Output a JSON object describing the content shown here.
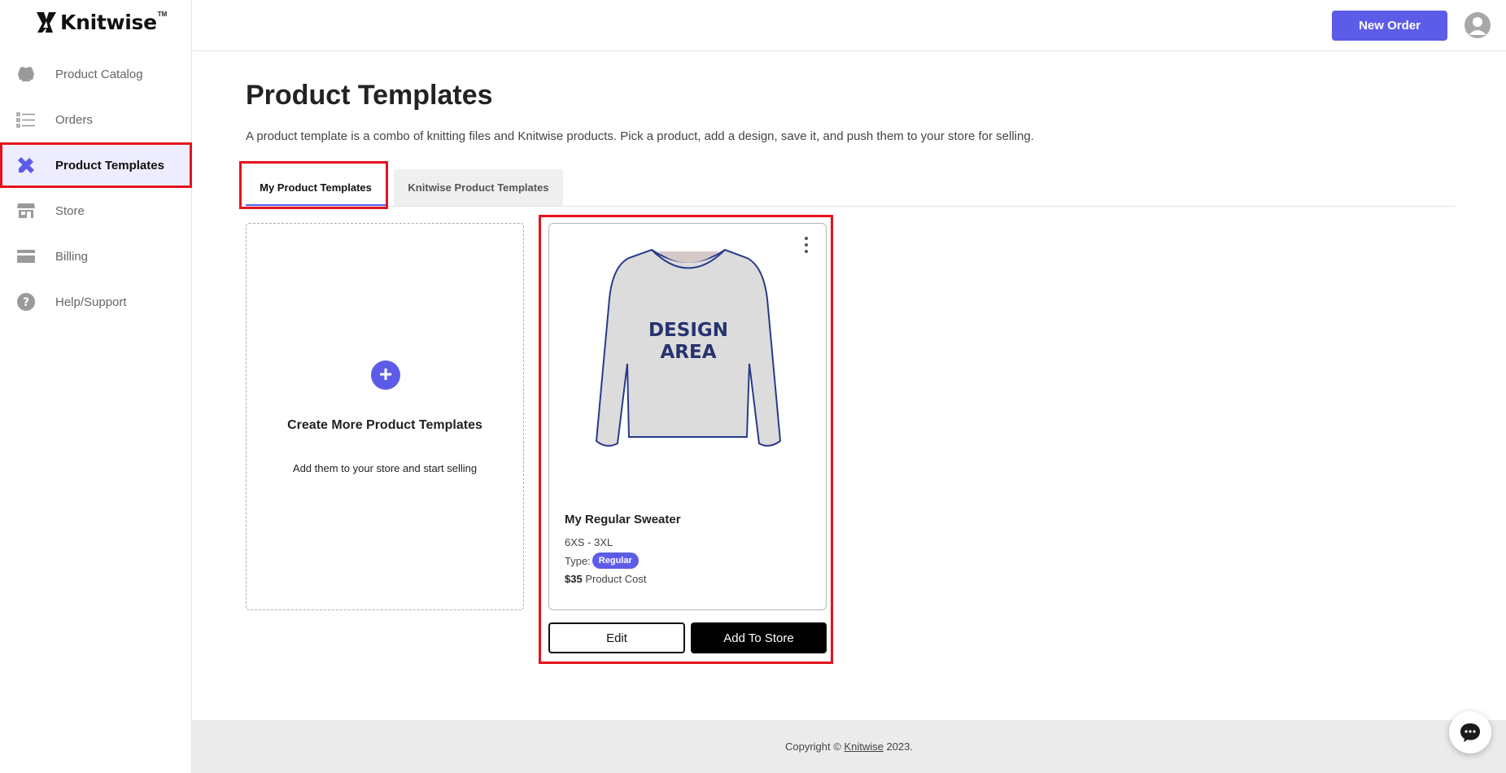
{
  "brand": {
    "name": "Knitwise",
    "tm": "TM"
  },
  "sidebar": {
    "items": [
      {
        "label": "Product Catalog",
        "icon": "sweater-icon"
      },
      {
        "label": "Orders",
        "icon": "list-icon"
      },
      {
        "label": "Product Templates",
        "icon": "pencil-ruler-icon",
        "active": true
      },
      {
        "label": "Store",
        "icon": "storefront-icon"
      },
      {
        "label": "Billing",
        "icon": "credit-card-icon"
      },
      {
        "label": "Help/Support",
        "icon": "question-icon"
      }
    ]
  },
  "header": {
    "new_order_label": "New Order",
    "avatar_icon": "user-icon"
  },
  "main": {
    "title": "Product Templates",
    "description": "A product template is a combo of knitting files and Knitwise products. Pick a product, add a design, save it, and push them to your store for selling.",
    "tabs": [
      {
        "label": "My Product Templates",
        "active": true
      },
      {
        "label": "Knitwise Product Templates",
        "active": false
      }
    ],
    "create_card": {
      "title": "Create More Product Templates",
      "subtitle": "Add them to your store and start selling"
    },
    "product_card": {
      "image_text_line1": "DESIGN",
      "image_text_line2": "AREA",
      "name": "My Regular Sweater",
      "sizes": "6XS - 3XL",
      "type_label": "Type:",
      "type_value": "Regular",
      "price": "$35",
      "price_label": "Product Cost",
      "edit_label": "Edit",
      "add_label": "Add To Store"
    }
  },
  "footer": {
    "prefix": "Copyright ©",
    "link": "Knitwise",
    "year": "2023."
  },
  "colors": {
    "accent": "#5d5ce8",
    "highlight": "#e5121f",
    "active_bg": "#ededff"
  }
}
